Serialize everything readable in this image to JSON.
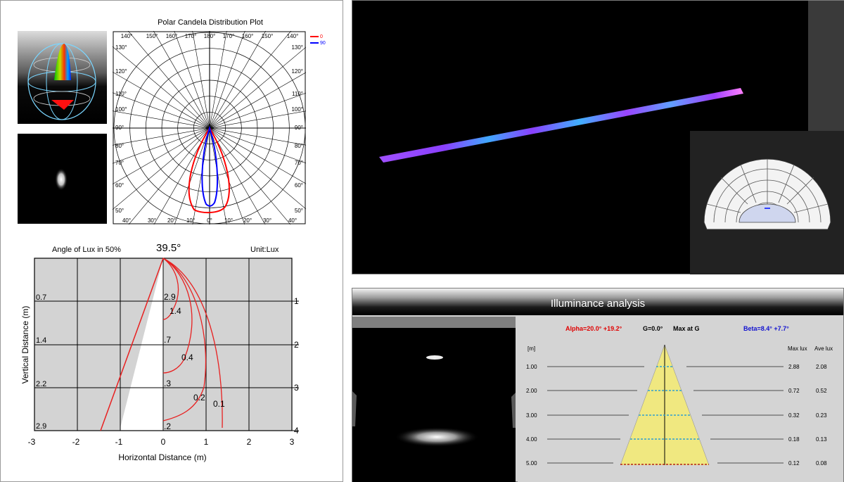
{
  "polar": {
    "title": "Polar Candela Distribution Plot",
    "legend": [
      {
        "label": "0",
        "color": "#ff0000"
      },
      {
        "label": "90",
        "color": "#0000ff"
      }
    ],
    "top_labels": [
      "140",
      "150",
      "160",
      "170",
      "180",
      "170",
      "160",
      "150",
      "140"
    ],
    "bottom_labels": [
      "40",
      "30",
      "20",
      "10",
      "0",
      "10",
      "20",
      "30",
      "40"
    ],
    "left_labels": [
      "130",
      "120",
      "110",
      "100",
      "90",
      "80",
      "70",
      "60",
      "50"
    ],
    "right_labels": [
      "130",
      "120",
      "110",
      "100",
      "90",
      "80",
      "70",
      "60",
      "50"
    ]
  },
  "lux_chart": {
    "angle_label": "Angle of Lux in 50%",
    "angle_value": "39.5°",
    "unit_label": "Unit:Lux",
    "xlabel": "Horizontal Distance (m)",
    "ylabel": "Vertical Distance (m)",
    "x_ticks": [
      "-3",
      "-2",
      "-1",
      "0",
      "1",
      "2",
      "3"
    ],
    "right_ticks": [
      "1",
      "2",
      "3",
      "4"
    ],
    "diameter_labels": [
      "0.7",
      "1.4",
      "2.2",
      "2.9"
    ],
    "contour_labels": [
      "2.9",
      "1.4",
      ".7",
      "0.4",
      ".3",
      "0.2",
      "0.1",
      ".2"
    ]
  },
  "illuminance": {
    "title": "Illuminance analysis",
    "alpha_label": "Alpha=20.0° +19.2°",
    "g_label": "G=0.0°",
    "max_at_label": "Max at G",
    "beta_label": "Beta=8.4° +7.7°",
    "col_unit": "[m]",
    "col_max": "Max lux",
    "col_ave": "Ave lux",
    "rows": [
      {
        "distance": "1.00",
        "max": "2.88",
        "ave": "2.08"
      },
      {
        "distance": "2.00",
        "max": "0.72",
        "ave": "0.52"
      },
      {
        "distance": "3.00",
        "max": "0.32",
        "ave": "0.23"
      },
      {
        "distance": "4.00",
        "max": "0.18",
        "ave": "0.13"
      },
      {
        "distance": "5.00",
        "max": "0.12",
        "ave": "0.08"
      }
    ],
    "alpha_color": "#e00000",
    "beta_color": "#1010d0"
  }
}
